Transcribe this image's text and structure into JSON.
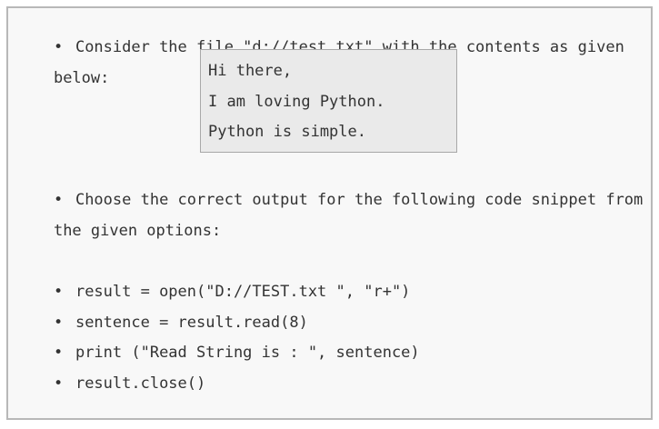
{
  "bullet": "•",
  "intro": {
    "line1": "Consider the file \"d://test.txt\" with the contents as given",
    "line2": "below:"
  },
  "file_contents": [
    "Hi there,",
    "I am loving Python.",
    "Python is simple."
  ],
  "question": {
    "line1": "Choose the correct output for the following code snippet from",
    "line2": "the given options:"
  },
  "code_lines": [
    "result = open(\"D://TEST.txt \", \"r+\")",
    "sentence = result.read(8)",
    "print (\"Read String is : \", sentence)",
    "result.close()"
  ]
}
